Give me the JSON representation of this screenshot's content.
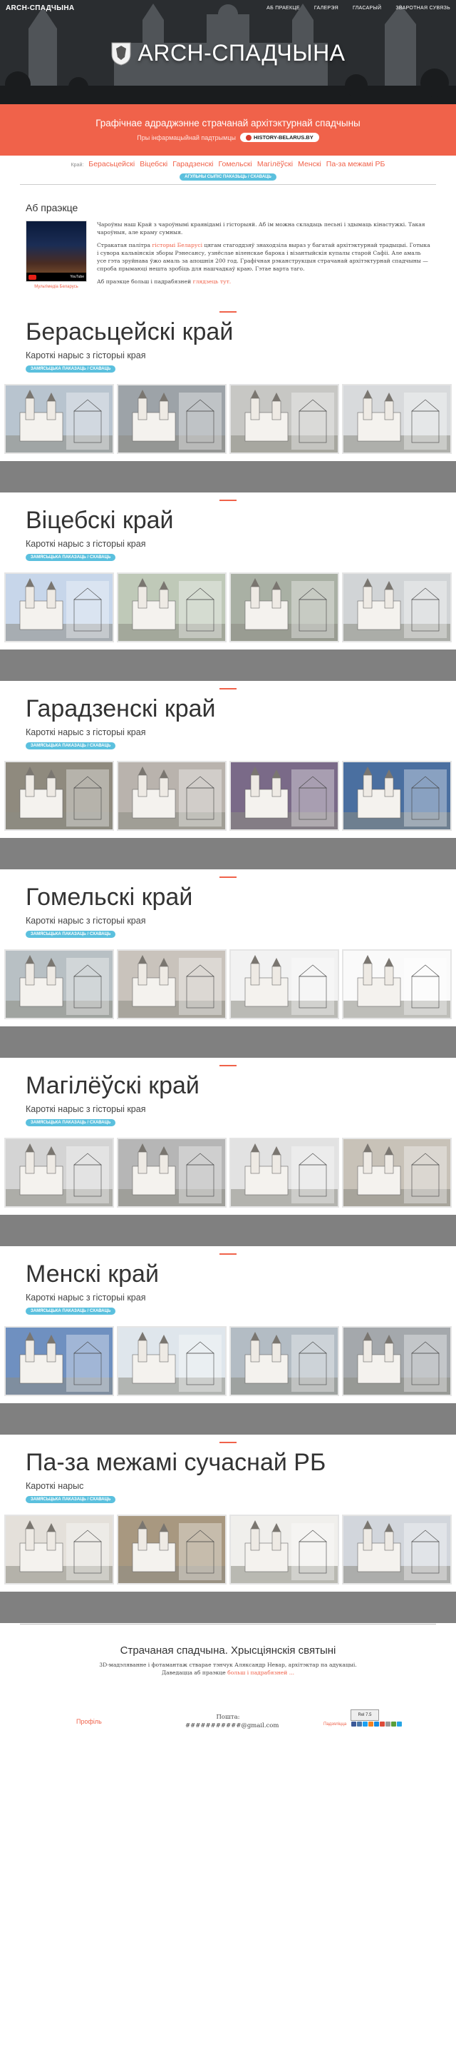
{
  "nav": {
    "brand": "ARCH-СПАДЧЫНА",
    "links": [
      "АБ ПРАЕКЦЕ",
      "ГАЛЕРЭЯ",
      "ГЛАСАРЫЙ",
      "ЗВАРОТНАЯ СУВЯЗЬ"
    ]
  },
  "hero": {
    "title": "ARCH-СПАДЧЫНА"
  },
  "banner": {
    "title": "Графічнае адраджэнне страчанай архітэктурнай спадчыны",
    "support_text": "Пры інфармацыйнай падтрымцы",
    "badge": "HISTORY-BELARUS.BY"
  },
  "regions_nav": {
    "label": "Край:",
    "items": [
      "Берасьцейскі",
      "Віцебскі",
      "Гарадзенскі",
      "Гомельскі",
      "Магілёўскі",
      "Менскі",
      "Па-за межамі РБ"
    ],
    "all_button": "АГУЛЬНЫ СЫПІС ПАКАЗЬЦЬ / СХАВАЦЬ"
  },
  "about": {
    "heading": "Аб праэкце",
    "video_caption": "Мультімедіа Беларусь",
    "video_brand": "YouTube",
    "p1": "Чароўны наш Край з чароўнымі краявідамі і гісторыяй. Аб ім можна складаць песьні і здымаць кінастужкі. Такая чароўныя, але краму сумныя.",
    "p2_before": "Стракатая палітра ",
    "p2_link": "гісторыі Беларусі",
    "p2_after": " цягам стагоддзяў знаходзіла выраз у багатай архітэктурнай традыцыі. Готыка і сувора кальвінскія зборы Рэнесансу, узнёслае віленскае барока і візантыйскія купалы старой Сафіі. Але амаль усе гэта зруйнава ўжо амаль за апошнія 200 год. Графічная рэканструкцыя страчанай архітэктурнай спадчыны — спроба прымаюці нешта зробіць для нашчадкаў краю. Гэтае варта таго.",
    "p3_before": "Аб праэкце больш і падрабязней ",
    "p3_link": "глядзець тут."
  },
  "sections": [
    {
      "title": "Берасьцейскі край",
      "subtitle": "Кароткі нарыс з гісторыі края",
      "button": "ЗАМЯСЬЦЬКА ПАКАЗАЦЬ / СХАВАЦЬ"
    },
    {
      "title": "Віцебскі край",
      "subtitle": "Кароткі нарыс з гісторыі края",
      "button": "ЗАМЯСЬЦЬКА ПАКАЗАЦЬ / СХАВАЦЬ"
    },
    {
      "title": "Гарадзенскі край",
      "subtitle": "Кароткі нарыс з гісторыі края",
      "button": "ЗАМЯСЬЦЬКА ПАКАЗАЦЬ / СХАВАЦЬ"
    },
    {
      "title": "Гомельскі край",
      "subtitle": "Кароткі нарыс з гісторыі края",
      "button": "ЗАМЯСЬЦЬКА ПАКАЗАЦЬ / СХАВАЦЬ"
    },
    {
      "title": "Магілёўскі край",
      "subtitle": "Кароткі нарыс з гісторыі края",
      "button": "ЗАМЯСЬЦЬКА ПАКАЗАЦЬ / СХАВАЦЬ"
    },
    {
      "title": "Менскі край",
      "subtitle": "Кароткі нарыс з гісторыі края",
      "button": "ЗАМЯСЬЦЬКА ПАКАЗАЦЬ / СХАВАЦЬ"
    },
    {
      "title": "Па-за межамі сучаснай РБ",
      "subtitle": "Кароткі нарыс",
      "button": "ЗАМЯСЬЦЬКА ПАКАЗАЦЬ / СХАВАЦЬ"
    }
  ],
  "footer": {
    "title": "Страчаная спадчына. Хрысціянскія святыні",
    "line1": "3D-мадэляванне і фотамантаж стварае тэнчук Аляксандр Невар, архітэктар па адукацыі.",
    "line2_before": "Даведацца аб праэкце ",
    "line2_link": "больш і падрабязней ...",
    "profile": "Профіль",
    "mail_label": "Пошта:",
    "mail_value": "###########@gmail.com",
    "share_label": "Падзяліцца",
    "counter": "Rel 7.5"
  },
  "colors": {
    "accent": "#f0624a",
    "pill": "#5bc0de",
    "band": "#808080"
  }
}
